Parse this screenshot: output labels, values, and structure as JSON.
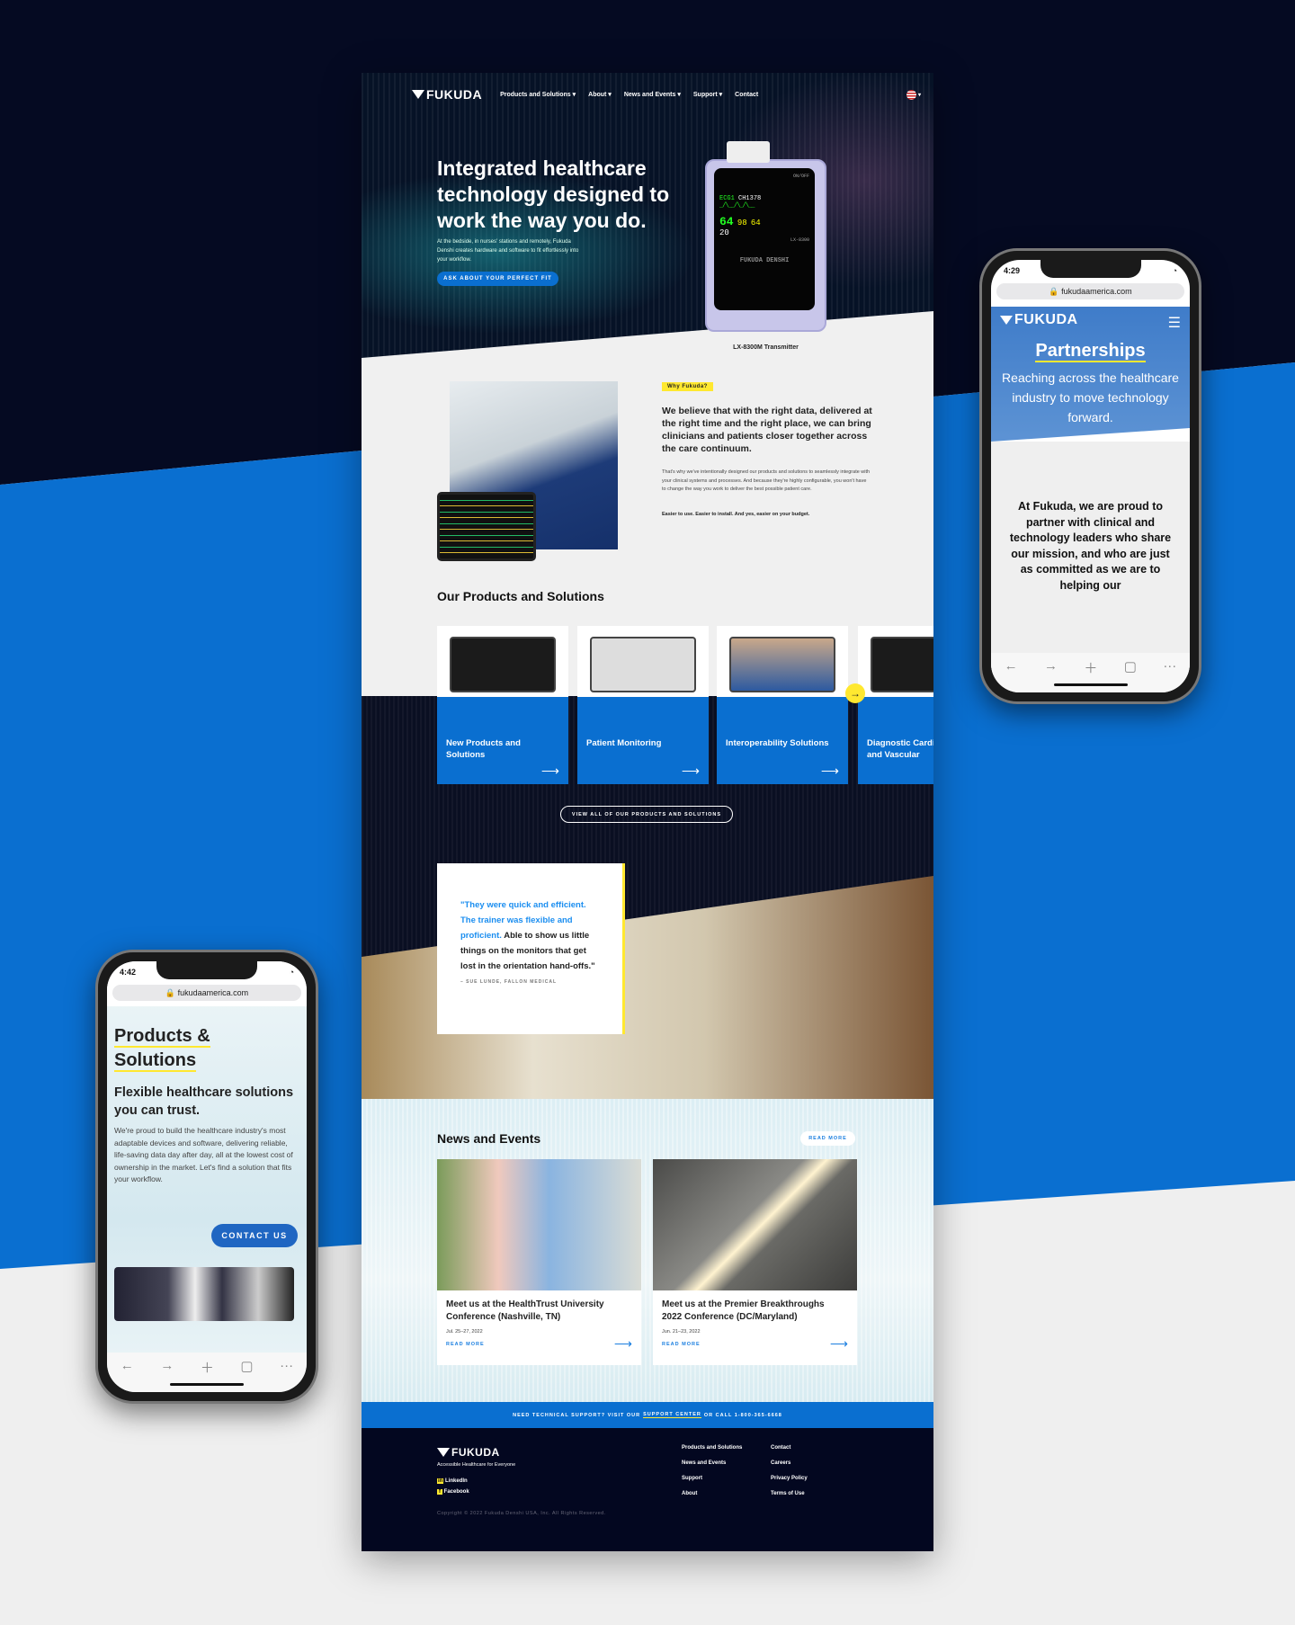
{
  "colors": {
    "navy": "#050a22",
    "brand_blue": "#0a6fd0",
    "accent_yellow": "#ffe830",
    "link_blue": "#1b7fe0"
  },
  "brand": "FUKUDA",
  "nav": {
    "items": [
      "Products and Solutions",
      "About",
      "News and Events",
      "Support",
      "Contact"
    ],
    "language_icon": "us-flag-icon"
  },
  "hero": {
    "title": "Integrated healthcare technology designed to work the way you do.",
    "body": "At the bedside, in nurses' stations and remotely, Fukuda Denshi creates hardware and software to fit effortlessly into your workflow.",
    "cta": "ASK ABOUT YOUR PERFECT FIT",
    "device_caption": "LX-8300M Transmitter",
    "device_screen": {
      "ecg": "ECG1",
      "ch": "CH1378",
      "hr": "64",
      "spo2": "98",
      "pr": "64",
      "rr": "20",
      "model": "LX-8300",
      "power": "ON/OFF",
      "brand": "FUKUDA DENSHI"
    }
  },
  "why": {
    "badge": "Why Fukuda?",
    "headline": "We believe that with the right data, delivered at the right time and the right place, we can bring clinicians and patients closer together across the care continuum.",
    "body": "That's why we've intentionally designed our products and solutions to seamlessly integrate with your clinical systems and processes. And because they're highly configurable, you won't have to change the way you work to deliver the best possible patient care.",
    "tagline": "Easier to use. Easier to install. And yes, easier on your budget."
  },
  "products": {
    "title": "Our Products and Solutions",
    "cards": [
      {
        "label": "New Products and Solutions"
      },
      {
        "label": "Patient Monitoring"
      },
      {
        "label": "Interoperability Solutions"
      },
      {
        "label": "Diagnostic Cardiology and Vascular"
      }
    ],
    "view_all": "VIEW ALL OF OUR PRODUCTS AND SOLUTIONS"
  },
  "quote": {
    "highlight": "\"They were quick and efficient. The trainer was flexible and proficient.",
    "rest": " Able to show us little things on the monitors that get lost in the orientation hand-offs.\"",
    "attribution": "– SUE LUNDE, FALLON MEDICAL"
  },
  "news": {
    "title": "News and Events",
    "read_more": "READ MORE",
    "items": [
      {
        "title": "Meet us at the HealthTrust University Conference (Nashville, TN)",
        "date": "Jul. 25–27, 2022",
        "link": "READ MORE"
      },
      {
        "title": "Meet us at the Premier Breakthroughs 2022 Conference (DC/Maryland)",
        "date": "Jun. 21–23, 2022",
        "link": "READ MORE"
      }
    ]
  },
  "support_bar": {
    "pre": "NEED TECHNICAL SUPPORT? VISIT OUR",
    "link": "SUPPORT CENTER",
    "post": "OR CALL 1-800-365-6668"
  },
  "footer": {
    "tagline": "Accessible Healthcare for Everyone",
    "social": [
      "LinkedIn",
      "Facebook"
    ],
    "col1": [
      "Products and Solutions",
      "News and Events",
      "Support",
      "About"
    ],
    "col2": [
      "Contact",
      "Careers",
      "Privacy Policy",
      "Terms of Use"
    ],
    "copyright": "Copyright © 2022 Fukuda Denshi USA, Inc. All Rights Reserved."
  },
  "phone_right": {
    "time": "4:29",
    "url": "fukudaamerica.com",
    "title": "Partnerships",
    "subtitle": "Reaching across the healthcare industry to move technology forward.",
    "body": "At Fukuda, we are proud to partner with clinical and technology leaders who share our mission, and who are just as committed as we are to helping our"
  },
  "phone_left": {
    "time": "4:42",
    "url": "fukudaamerica.com",
    "title_line1": "Products &",
    "title_line2": "Solutions",
    "subtitle": "Flexible healthcare solutions you can trust.",
    "body": "We're proud to build the healthcare industry's most adaptable devices and software, delivering reliable, life-saving data day after day, all at the lowest cost of ownership in the market. Let's find a solution that fits your workflow.",
    "cta": "CONTACT US"
  }
}
